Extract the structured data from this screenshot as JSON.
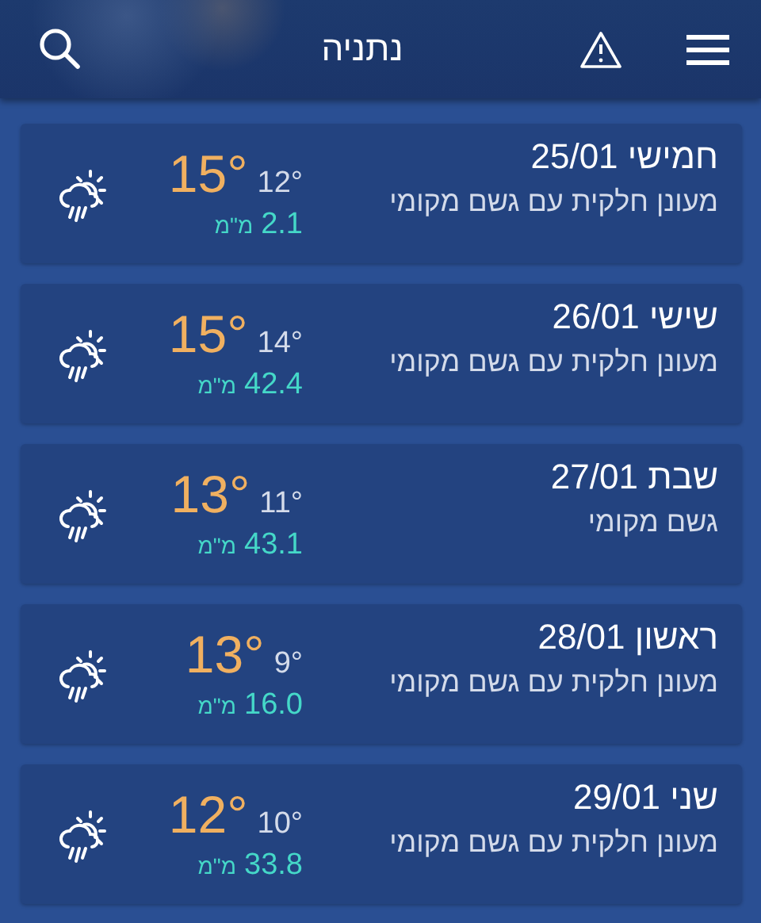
{
  "header": {
    "title": "נתניה"
  },
  "days": [
    {
      "date": "חמישי 25/01",
      "description": "מעונן חלקית עם גשם מקומי",
      "high": "15°",
      "low": "12°",
      "rain": "2.1",
      "rain_unit": "מ\"מ"
    },
    {
      "date": "שישי 26/01",
      "description": "מעונן חלקית עם גשם מקומי",
      "high": "15°",
      "low": "14°",
      "rain": "42.4",
      "rain_unit": "מ\"מ"
    },
    {
      "date": "שבת 27/01",
      "description": "גשם מקומי",
      "high": "13°",
      "low": "11°",
      "rain": "43.1",
      "rain_unit": "מ\"מ"
    },
    {
      "date": "ראשון 28/01",
      "description": "מעונן חלקית עם גשם מקומי",
      "high": "13°",
      "low": "9°",
      "rain": "16.0",
      "rain_unit": "מ\"מ"
    },
    {
      "date": "שני 29/01",
      "description": "מעונן חלקית עם גשם מקומי",
      "high": "12°",
      "low": "10°",
      "rain": "33.8",
      "rain_unit": "מ\"מ"
    }
  ]
}
